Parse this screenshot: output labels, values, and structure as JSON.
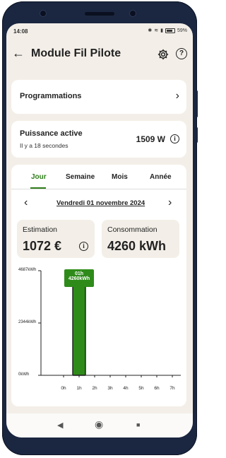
{
  "status": {
    "time": "14:08",
    "battery": "59%"
  },
  "appbar": {
    "title": "Module Fil Pilote",
    "back_icon": "arrow-left-icon",
    "settings_icon": "gear-icon",
    "help_icon": "help-circle-icon",
    "help_glyph": "?"
  },
  "programmations": {
    "label": "Programmations",
    "chevron": "›"
  },
  "puissance": {
    "label": "Puissance active",
    "subtitle": "Il y a 18 secondes",
    "value": "1509 W",
    "info_glyph": "i"
  },
  "tabs": [
    "Jour",
    "Semaine",
    "Mois",
    "Année"
  ],
  "active_tab": "Jour",
  "date": {
    "label": "Vendredi 01 novembre 2024",
    "prev": "‹",
    "next": "›"
  },
  "estimation": {
    "label": "Estimation",
    "value": "1072 €",
    "info_glyph": "i"
  },
  "consommation": {
    "label": "Consommation",
    "value": "4260 kWh"
  },
  "tooltip": {
    "hour": "01h",
    "value": "4260kWh"
  },
  "colors": {
    "accent": "#2e7d1a",
    "bar": "#2e8b1a",
    "background": "#f3efe8"
  },
  "nav": {
    "back": "◀",
    "home": "◉",
    "recents": "■"
  },
  "chart_data": {
    "type": "bar",
    "categories": [
      "0h",
      "1h",
      "2h",
      "3h",
      "4h",
      "5h",
      "6h",
      "7h"
    ],
    "values": [
      0,
      4260,
      0,
      0,
      0,
      0,
      0,
      0
    ],
    "yticks": [
      "4687kWh",
      "2344kWh",
      "0kWh"
    ],
    "ylim": [
      0,
      4687
    ],
    "ylabel": "kWh"
  }
}
